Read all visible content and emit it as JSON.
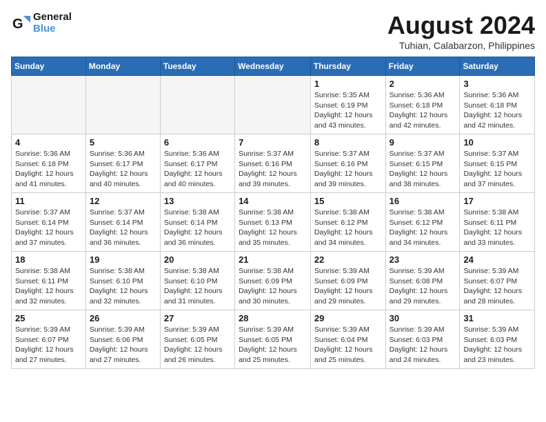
{
  "header": {
    "logo_line1": "General",
    "logo_line2": "Blue",
    "month_year": "August 2024",
    "location": "Tuhian, Calabarzon, Philippines"
  },
  "weekdays": [
    "Sunday",
    "Monday",
    "Tuesday",
    "Wednesday",
    "Thursday",
    "Friday",
    "Saturday"
  ],
  "weeks": [
    [
      {
        "day": "",
        "info": ""
      },
      {
        "day": "",
        "info": ""
      },
      {
        "day": "",
        "info": ""
      },
      {
        "day": "",
        "info": ""
      },
      {
        "day": "1",
        "info": "Sunrise: 5:35 AM\nSunset: 6:19 PM\nDaylight: 12 hours\nand 43 minutes."
      },
      {
        "day": "2",
        "info": "Sunrise: 5:36 AM\nSunset: 6:18 PM\nDaylight: 12 hours\nand 42 minutes."
      },
      {
        "day": "3",
        "info": "Sunrise: 5:36 AM\nSunset: 6:18 PM\nDaylight: 12 hours\nand 42 minutes."
      }
    ],
    [
      {
        "day": "4",
        "info": "Sunrise: 5:36 AM\nSunset: 6:18 PM\nDaylight: 12 hours\nand 41 minutes."
      },
      {
        "day": "5",
        "info": "Sunrise: 5:36 AM\nSunset: 6:17 PM\nDaylight: 12 hours\nand 40 minutes."
      },
      {
        "day": "6",
        "info": "Sunrise: 5:36 AM\nSunset: 6:17 PM\nDaylight: 12 hours\nand 40 minutes."
      },
      {
        "day": "7",
        "info": "Sunrise: 5:37 AM\nSunset: 6:16 PM\nDaylight: 12 hours\nand 39 minutes."
      },
      {
        "day": "8",
        "info": "Sunrise: 5:37 AM\nSunset: 6:16 PM\nDaylight: 12 hours\nand 39 minutes."
      },
      {
        "day": "9",
        "info": "Sunrise: 5:37 AM\nSunset: 6:15 PM\nDaylight: 12 hours\nand 38 minutes."
      },
      {
        "day": "10",
        "info": "Sunrise: 5:37 AM\nSunset: 6:15 PM\nDaylight: 12 hours\nand 37 minutes."
      }
    ],
    [
      {
        "day": "11",
        "info": "Sunrise: 5:37 AM\nSunset: 6:14 PM\nDaylight: 12 hours\nand 37 minutes."
      },
      {
        "day": "12",
        "info": "Sunrise: 5:37 AM\nSunset: 6:14 PM\nDaylight: 12 hours\nand 36 minutes."
      },
      {
        "day": "13",
        "info": "Sunrise: 5:38 AM\nSunset: 6:14 PM\nDaylight: 12 hours\nand 36 minutes."
      },
      {
        "day": "14",
        "info": "Sunrise: 5:38 AM\nSunset: 6:13 PM\nDaylight: 12 hours\nand 35 minutes."
      },
      {
        "day": "15",
        "info": "Sunrise: 5:38 AM\nSunset: 6:12 PM\nDaylight: 12 hours\nand 34 minutes."
      },
      {
        "day": "16",
        "info": "Sunrise: 5:38 AM\nSunset: 6:12 PM\nDaylight: 12 hours\nand 34 minutes."
      },
      {
        "day": "17",
        "info": "Sunrise: 5:38 AM\nSunset: 6:11 PM\nDaylight: 12 hours\nand 33 minutes."
      }
    ],
    [
      {
        "day": "18",
        "info": "Sunrise: 5:38 AM\nSunset: 6:11 PM\nDaylight: 12 hours\nand 32 minutes."
      },
      {
        "day": "19",
        "info": "Sunrise: 5:38 AM\nSunset: 6:10 PM\nDaylight: 12 hours\nand 32 minutes."
      },
      {
        "day": "20",
        "info": "Sunrise: 5:38 AM\nSunset: 6:10 PM\nDaylight: 12 hours\nand 31 minutes."
      },
      {
        "day": "21",
        "info": "Sunrise: 5:38 AM\nSunset: 6:09 PM\nDaylight: 12 hours\nand 30 minutes."
      },
      {
        "day": "22",
        "info": "Sunrise: 5:39 AM\nSunset: 6:09 PM\nDaylight: 12 hours\nand 29 minutes."
      },
      {
        "day": "23",
        "info": "Sunrise: 5:39 AM\nSunset: 6:08 PM\nDaylight: 12 hours\nand 29 minutes."
      },
      {
        "day": "24",
        "info": "Sunrise: 5:39 AM\nSunset: 6:07 PM\nDaylight: 12 hours\nand 28 minutes."
      }
    ],
    [
      {
        "day": "25",
        "info": "Sunrise: 5:39 AM\nSunset: 6:07 PM\nDaylight: 12 hours\nand 27 minutes."
      },
      {
        "day": "26",
        "info": "Sunrise: 5:39 AM\nSunset: 6:06 PM\nDaylight: 12 hours\nand 27 minutes."
      },
      {
        "day": "27",
        "info": "Sunrise: 5:39 AM\nSunset: 6:05 PM\nDaylight: 12 hours\nand 26 minutes."
      },
      {
        "day": "28",
        "info": "Sunrise: 5:39 AM\nSunset: 6:05 PM\nDaylight: 12 hours\nand 25 minutes."
      },
      {
        "day": "29",
        "info": "Sunrise: 5:39 AM\nSunset: 6:04 PM\nDaylight: 12 hours\nand 25 minutes."
      },
      {
        "day": "30",
        "info": "Sunrise: 5:39 AM\nSunset: 6:03 PM\nDaylight: 12 hours\nand 24 minutes."
      },
      {
        "day": "31",
        "info": "Sunrise: 5:39 AM\nSunset: 6:03 PM\nDaylight: 12 hours\nand 23 minutes."
      }
    ]
  ]
}
